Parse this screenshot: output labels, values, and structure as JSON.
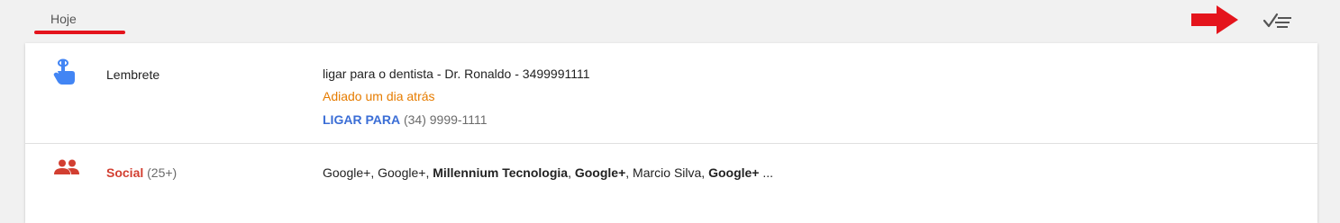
{
  "section": {
    "title": "Hoje"
  },
  "colors": {
    "accent_red": "#e4141c",
    "reminder_blue": "#4285f4",
    "social_red": "#d23f31",
    "snooze_orange": "#e67c00",
    "action_blue": "#3b6ed6"
  },
  "toolbar": {
    "sweep_icon": "sweep-done-icon",
    "arrow_icon": "red-arrow-icon"
  },
  "rows": [
    {
      "type": "reminder",
      "icon": "reminder-finger-icon",
      "label": "Lembrete",
      "text": "ligar para o dentista - Dr. Ronaldo - 3499991111",
      "status": "Adiado um dia atrás",
      "action_label": "LIGAR PARA",
      "action_value": "(34) 9999-1111"
    },
    {
      "type": "bundle",
      "icon": "people-icon",
      "label": "Social",
      "count": "(25+)",
      "senders": [
        {
          "name": "Google+",
          "bold": false
        },
        {
          "name": "Google+",
          "bold": false
        },
        {
          "name": "Millennium Tecnologia",
          "bold": true
        },
        {
          "name": "Google+",
          "bold": true
        },
        {
          "name": "Marcio Silva",
          "bold": false
        },
        {
          "name": "Google+",
          "bold": true
        }
      ],
      "ellipsis": "..."
    }
  ]
}
